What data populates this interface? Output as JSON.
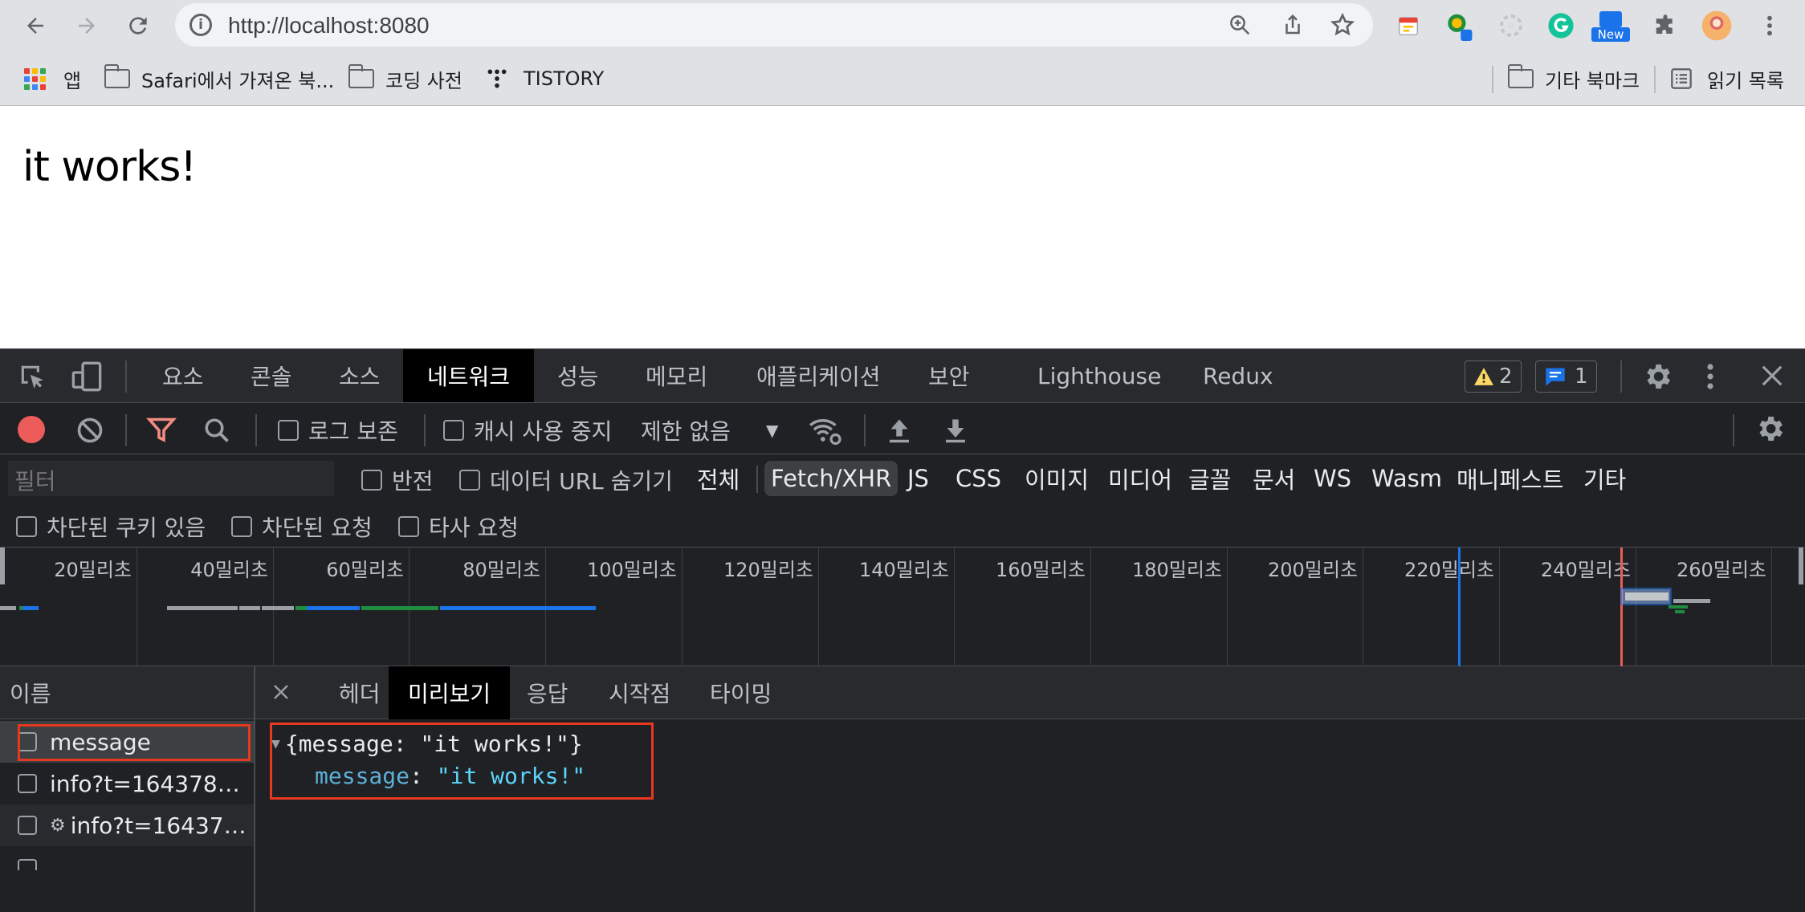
{
  "browser": {
    "url": "http://localhost:8080",
    "new_badge": "New",
    "bookmarks": [
      {
        "label": "앱",
        "icon": "apps-grid-icon"
      },
      {
        "label": "Safari에서 가져온 북...",
        "icon": "folder-icon"
      },
      {
        "label": "코딩 사전",
        "icon": "folder-icon"
      },
      {
        "label": "TISTORY",
        "icon": "tistory-icon"
      }
    ],
    "other_bookmarks": "기타 북마크",
    "reading_list": "읽기 목록"
  },
  "page": {
    "heading": "it works!"
  },
  "devtools": {
    "tabs": [
      "요소",
      "콘솔",
      "소스",
      "네트워크",
      "성능",
      "메모리",
      "애플리케이션",
      "보안",
      "Lighthouse",
      "Redux"
    ],
    "active_tab": "네트워크",
    "warnings_count": "2",
    "messages_count": "1",
    "network": {
      "preserve_log": "로그 보존",
      "disable_cache": "캐시 사용 중지",
      "throttling": "제한 없음",
      "filter_placeholder": "필터",
      "invert": "반전",
      "hide_data_urls": "데이터 URL 숨기기",
      "types": [
        "전체",
        "Fetch/XHR",
        "JS",
        "CSS",
        "이미지",
        "미디어",
        "글꼴",
        "문서",
        "WS",
        "Wasm",
        "매니페스트",
        "기타"
      ],
      "active_type": "Fetch/XHR",
      "blocked_cookies": "차단된 쿠키 있음",
      "blocked_requests": "차단된 요청",
      "third_party": "타사 요청",
      "timeline_ticks": [
        "20밀리초",
        "40밀리초",
        "60밀리초",
        "80밀리초",
        "100밀리초",
        "120밀리초",
        "140밀리초",
        "160밀리초",
        "180밀리초",
        "200밀리초",
        "220밀리초",
        "240밀리초",
        "260밀리초"
      ],
      "name_header": "이름",
      "requests": [
        "message",
        "info?t=164378…",
        "info?t=16437…"
      ],
      "detail_tabs": [
        "헤더",
        "미리보기",
        "응답",
        "시작점",
        "타이밍"
      ],
      "active_detail_tab": "미리보기",
      "preview": {
        "summary": "{message: \"it works!\"}",
        "key": "message",
        "colon": ": ",
        "value": "\"it works!\""
      }
    }
  },
  "colors": {
    "record_red": "#ee5b5b",
    "filter_red": "#f28b82",
    "warning_yellow": "#fdd663",
    "message_blue": "#1a73e8",
    "highlight_box": "#e8381f",
    "json_key": "#5db0d7",
    "json_string": "#5cd5fb"
  }
}
